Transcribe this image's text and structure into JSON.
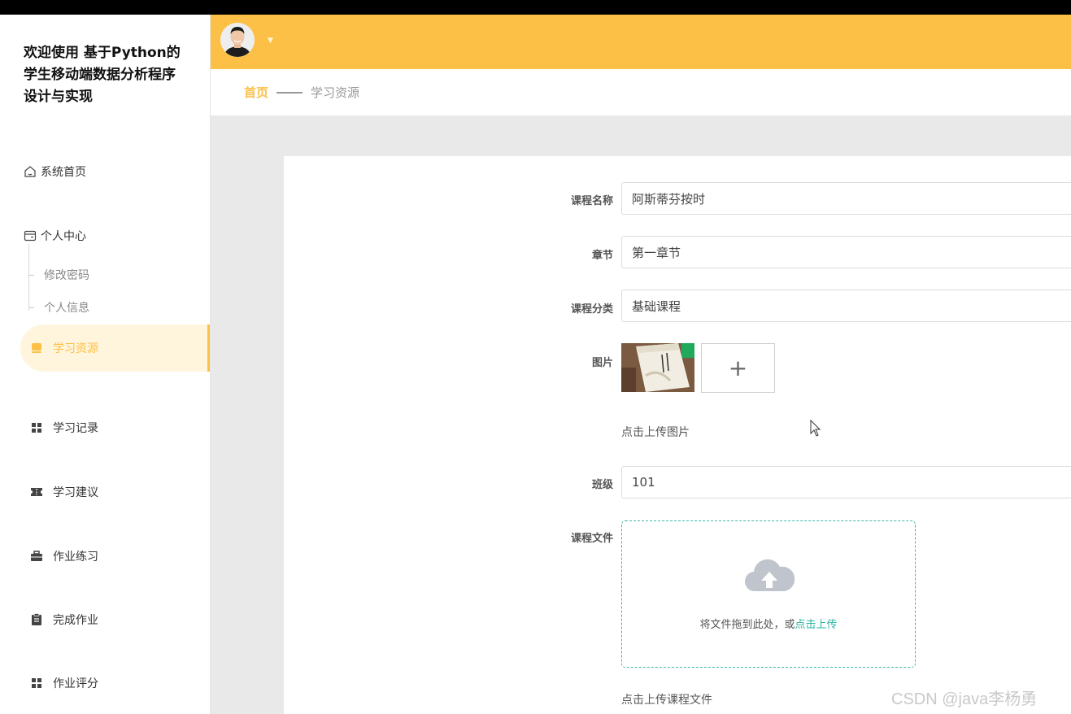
{
  "app": {
    "title_line1": "欢迎使用 基于Python的",
    "title_line2": "学生移动端数据分析程序",
    "title_line3": "设计与实现"
  },
  "sidebar": {
    "home": "系统首页",
    "personal_center": "个人中心",
    "sub_items": [
      "修改密码",
      "个人信息"
    ],
    "items": [
      {
        "label": "学习资源",
        "active": true
      },
      {
        "label": "学习记录"
      },
      {
        "label": "学习建议"
      },
      {
        "label": "作业练习"
      },
      {
        "label": "完成作业"
      },
      {
        "label": "作业评分"
      }
    ]
  },
  "breadcrumb": {
    "home": "首页",
    "current": "学习资源"
  },
  "form": {
    "course_name": {
      "label": "课程名称",
      "value": "阿斯蒂芬按时"
    },
    "chapter": {
      "label": "章节",
      "value": "第一章节"
    },
    "category": {
      "label": "课程分类",
      "value": "基础课程"
    },
    "image": {
      "label": "图片",
      "add_symbol": "+",
      "hint": "点击上传图片"
    },
    "class": {
      "label": "班级",
      "value": "101"
    },
    "course_file": {
      "label": "课程文件",
      "drop_text": "将文件拖到此处，或",
      "drop_link": "点击上传",
      "hint": "点击上传课程文件"
    }
  },
  "watermark": "CSDN @java李杨勇",
  "colors": {
    "accent": "#fcc047",
    "active_bg": "#fff5dc",
    "upload_border": "#3fb8a4",
    "upload_link": "#2bb3a1"
  }
}
